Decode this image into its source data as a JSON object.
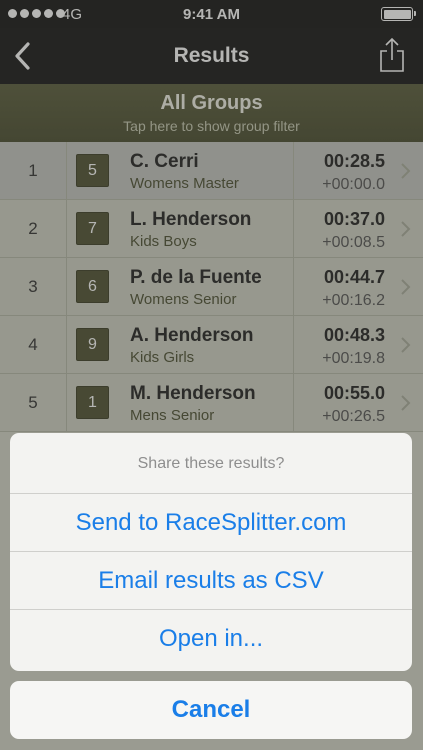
{
  "status_bar": {
    "carrier": "4G",
    "time": "9:41 AM",
    "signal_bars": 5,
    "battery_level": 1.0
  },
  "nav": {
    "title": "Results",
    "back_icon": "chevron-left-icon",
    "share_icon": "share-icon"
  },
  "group_filter": {
    "title": "All Groups",
    "subtitle": "Tap here to show group filter"
  },
  "results": [
    {
      "rank": "1",
      "bib": "5",
      "name": "C. Cerri",
      "group": "Womens Master",
      "time": "00:28.5",
      "diff": "+00:00.0",
      "selected": true
    },
    {
      "rank": "2",
      "bib": "7",
      "name": "L. Henderson",
      "group": "Kids Boys",
      "time": "00:37.0",
      "diff": "+00:08.5"
    },
    {
      "rank": "3",
      "bib": "6",
      "name": "P. de la Fuente",
      "group": "Womens Senior",
      "time": "00:44.7",
      "diff": "+00:16.2"
    },
    {
      "rank": "4",
      "bib": "9",
      "name": "A. Henderson",
      "group": "Kids Girls",
      "time": "00:48.3",
      "diff": "+00:19.8"
    },
    {
      "rank": "5",
      "bib": "1",
      "name": "M. Henderson",
      "group": "Mens Senior",
      "time": "00:55.0",
      "diff": "+00:26.5"
    }
  ],
  "action_sheet": {
    "title": "Share these results?",
    "actions": [
      "Send to RaceSplitter.com",
      "Email results as CSV",
      "Open in..."
    ],
    "cancel": "Cancel"
  },
  "colors": {
    "accent": "#1a7ee8",
    "header_olive": "#55583a",
    "badge": "#4f5233"
  }
}
